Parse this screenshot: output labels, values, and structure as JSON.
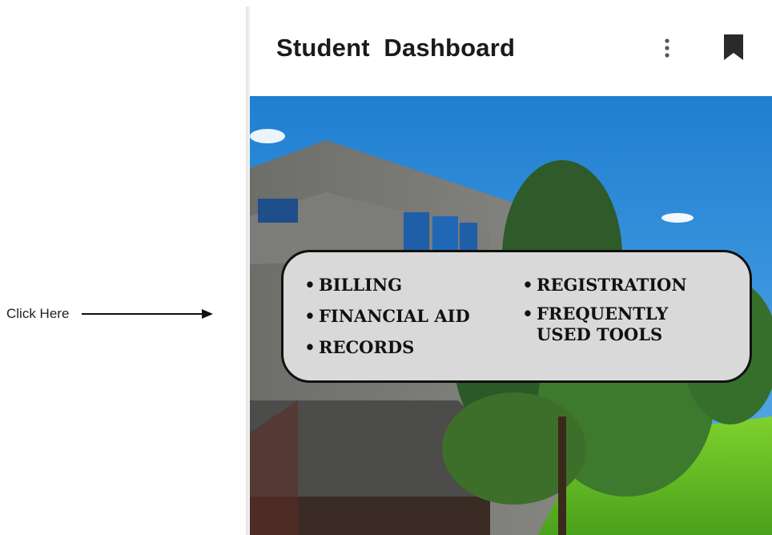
{
  "annotation": {
    "label": "Click Here"
  },
  "card": {
    "title": "Student  Dashboard",
    "icons": {
      "more": "more-vert-icon",
      "bookmark": "bookmark-icon"
    }
  },
  "menu": {
    "bullet": "•",
    "left_items": [
      {
        "label": "BILLING"
      },
      {
        "label": "FINANCIAL AID"
      },
      {
        "label": "RECORDS"
      }
    ],
    "right_items": [
      {
        "label": "REGISTRATION"
      },
      {
        "label": "FREQUENTLY\nUSED TOOLS"
      }
    ]
  },
  "colors": {
    "sky": "#2f86d6",
    "box_fill": "#d9d9d9",
    "box_border": "#111111",
    "title": "#1a1a1a"
  }
}
